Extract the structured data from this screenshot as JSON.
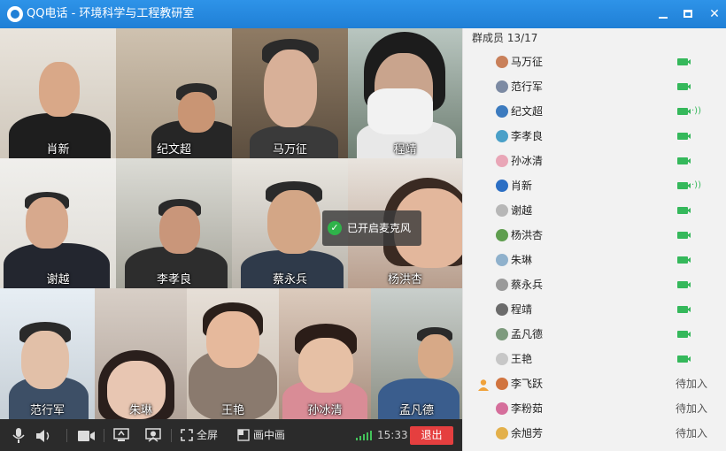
{
  "window": {
    "title": "QQ电话 - 环境科学与工程教研室"
  },
  "videos": [
    {
      "name": "肖新"
    },
    {
      "name": "纪文超"
    },
    {
      "name": "马万征"
    },
    {
      "name": "程靖"
    },
    {
      "name": "谢越"
    },
    {
      "name": "李孝良"
    },
    {
      "name": "蔡永兵"
    },
    {
      "name": "杨洪杏"
    },
    {
      "name": "范行军"
    },
    {
      "name": "朱琳"
    },
    {
      "name": "王艳"
    },
    {
      "name": "孙冰清"
    },
    {
      "name": "孟凡德"
    }
  ],
  "toast": {
    "text": "已开启麦克风"
  },
  "toolbar": {
    "fullscreen_label": "全屏",
    "pip_label": "画中画",
    "time": "15:33",
    "exit_label": "退出"
  },
  "panel": {
    "header": "群成员 13/17",
    "members": [
      {
        "name": "马万征",
        "status": "video",
        "avatar_color": "#c9805a"
      },
      {
        "name": "范行军",
        "status": "video",
        "avatar_color": "#7c8aa3"
      },
      {
        "name": "纪文超",
        "status": "video-speaking",
        "avatar_color": "#3c7bbf"
      },
      {
        "name": "李孝良",
        "status": "video",
        "avatar_color": "#4aa0c8"
      },
      {
        "name": "孙冰清",
        "status": "video",
        "avatar_color": "#e9a6b7"
      },
      {
        "name": "肖新",
        "status": "video-speaking",
        "avatar_color": "#2c6fc4"
      },
      {
        "name": "谢越",
        "status": "video",
        "avatar_color": "#b7b7b7"
      },
      {
        "name": "杨洪杏",
        "status": "video",
        "avatar_color": "#5f9e4f"
      },
      {
        "name": "朱琳",
        "status": "video",
        "avatar_color": "#8fb1cc"
      },
      {
        "name": "蔡永兵",
        "status": "video",
        "avatar_color": "#9a9a9a"
      },
      {
        "name": "程靖",
        "status": "video",
        "avatar_color": "#6b6b6b"
      },
      {
        "name": "孟凡德",
        "status": "video",
        "avatar_color": "#7d9a7d"
      },
      {
        "name": "王艳",
        "status": "video",
        "avatar_color": "#c7c7c7"
      },
      {
        "name": "李飞跃",
        "status": "待加入",
        "avatar_color": "#d1743f",
        "inviter": true
      },
      {
        "name": "李粉茹",
        "status": "待加入",
        "avatar_color": "#d56e9b"
      },
      {
        "name": "余旭芳",
        "status": "待加入",
        "avatar_color": "#e3b04a"
      }
    ]
  },
  "colors": {
    "titlebar": "#2188e0",
    "online_green": "#35b85b",
    "exit_red": "#e53f3f"
  }
}
